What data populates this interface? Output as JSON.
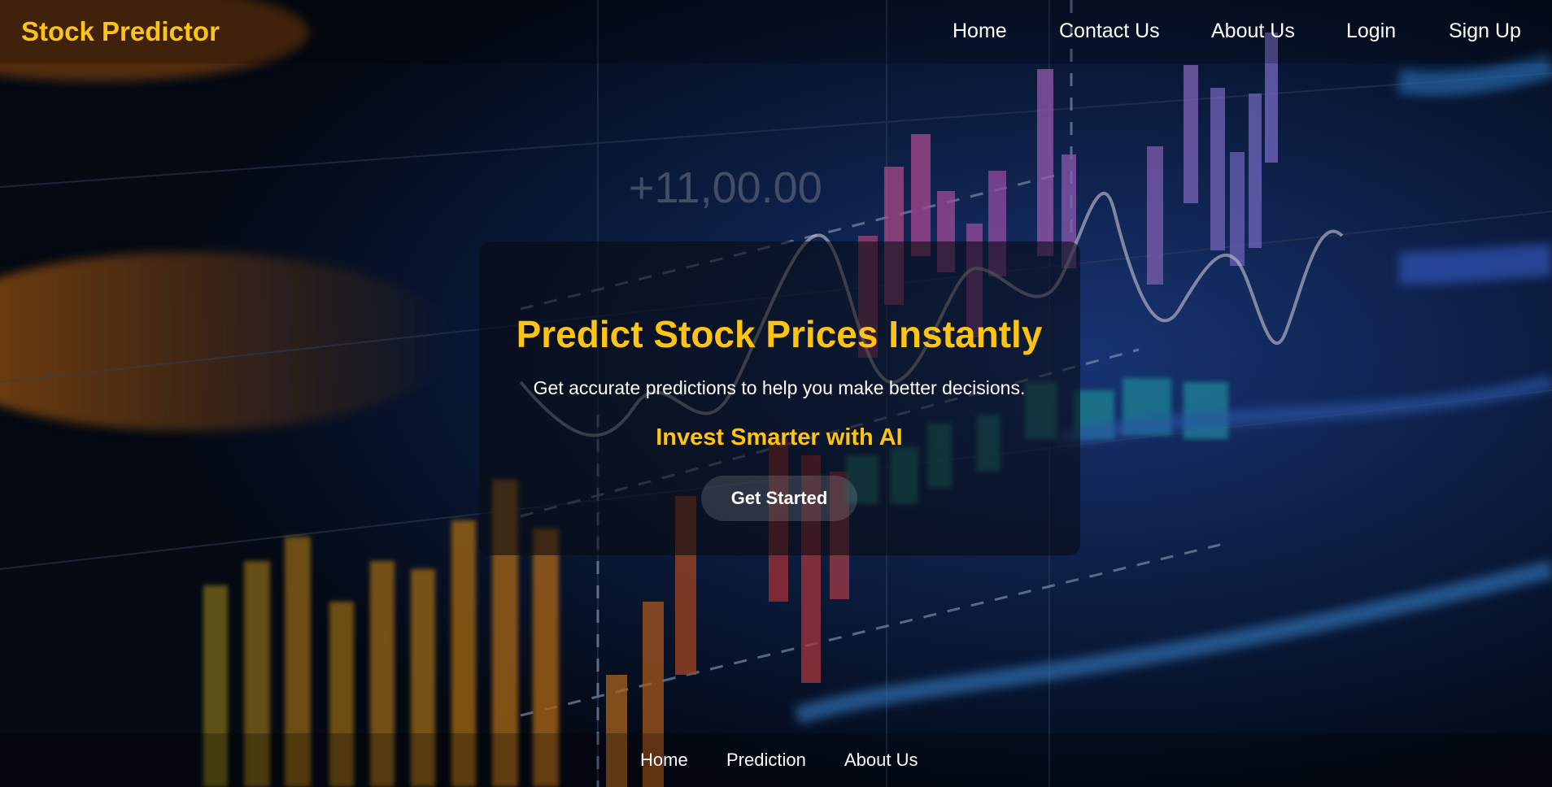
{
  "header": {
    "brand": "Stock Predictor",
    "nav": [
      "Home",
      "Contact Us",
      "About Us",
      "Login",
      "Sign Up"
    ]
  },
  "hero": {
    "title": "Predict Stock Prices Instantly",
    "subtitle": "Get accurate predictions to help you make better decisions.",
    "tagline": "Invest Smarter with AI",
    "cta": "Get Started"
  },
  "background": {
    "price_label": "+11,00.00"
  },
  "footer": {
    "links": [
      "Home",
      "Prediction",
      "About Us"
    ]
  },
  "colors": {
    "accent": "#ffc312",
    "text": "#ffffff",
    "background": "#07101f"
  }
}
